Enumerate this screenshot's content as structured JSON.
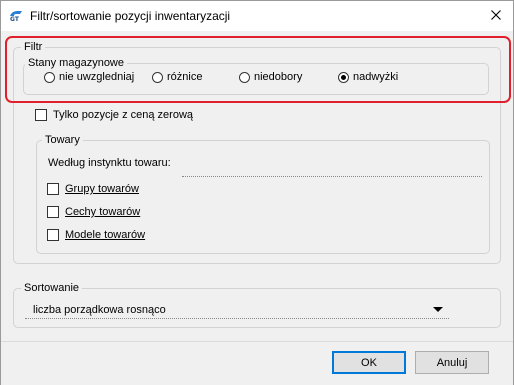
{
  "window": {
    "title": "Filtr/sortowanie pozycji inwentaryzacji",
    "icon": "app-logo-icon",
    "close_icon": "close-icon"
  },
  "filter": {
    "group_label": "Filtr",
    "stock": {
      "group_label": "Stany magazynowe",
      "options": [
        {
          "label": "nie uwzgledniaj",
          "checked": false
        },
        {
          "label": "różnice",
          "checked": false
        },
        {
          "label": "niedobory",
          "checked": false
        },
        {
          "label": "nadwyżki",
          "checked": true
        }
      ]
    },
    "zero_price": {
      "label": "Tylko pozycje z ceną zerową",
      "checked": false
    },
    "goods": {
      "group_label": "Towary",
      "instinct_label": "Według instynktu towaru:",
      "instinct_value": "",
      "checks": [
        {
          "label": "Grupy towarów",
          "checked": false
        },
        {
          "label": "Cechy towarów",
          "checked": false
        },
        {
          "label": "Modele towarów",
          "checked": false
        }
      ]
    }
  },
  "sorting": {
    "group_label": "Sortowanie",
    "selected": "liczba porządkowa rosnąco"
  },
  "buttons": {
    "ok": "OK",
    "cancel": "Anuluj"
  },
  "colors": {
    "highlight": "#e0202c",
    "default_button_border": "#0078d7",
    "dialog_background": "#f0f0f0"
  }
}
